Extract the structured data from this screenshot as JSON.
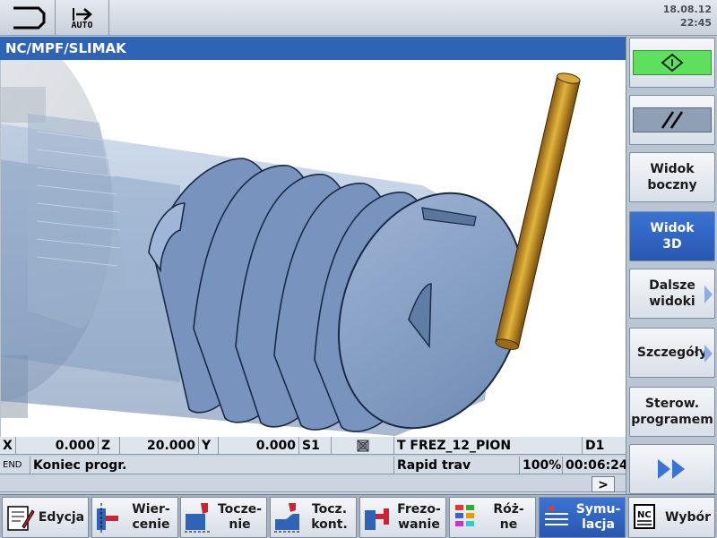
{
  "header": {
    "mode_label": "AUTO",
    "date": "18.08.12",
    "time": "22:45"
  },
  "title": "NC/MPF/SLIMAK",
  "status": {
    "x_label": "X",
    "x_value": "0.000",
    "z_label": "Z",
    "z_value": "20.000",
    "y_label": "Y",
    "y_value": "0.000",
    "s_label": "S1",
    "tool": "T FREZ_12_PION",
    "d": "D1",
    "end_label": "END",
    "message": "Koniec progr.",
    "feed_mode": "Rapid trav",
    "override": "100%",
    "run_time": "00:06:24",
    "expand": ">"
  },
  "vertical_softkeys": [
    {
      "label": "",
      "icon": "start-icon"
    },
    {
      "label": "",
      "icon": "parallel-lines-icon"
    },
    {
      "label": "Widok\nboczny"
    },
    {
      "label": "Widok\n3D",
      "active": true
    },
    {
      "label": "Dalsze\nwidoki"
    },
    {
      "label": "Szczegóły"
    },
    {
      "label": "Sterow.\nprogramem"
    },
    {
      "label": "",
      "icon": "double-right-arrow-icon"
    }
  ],
  "horizontal_softkeys": [
    {
      "label": "Edycja",
      "icon": "edit-icon"
    },
    {
      "label": "Wier-\ncenie",
      "icon": "drilling-icon"
    },
    {
      "label": "Tocze-\nnie",
      "icon": "turning-icon"
    },
    {
      "label": "Tocz.\nkont.",
      "icon": "contour-turning-icon"
    },
    {
      "label": "Frezo-\nwanie",
      "icon": "milling-icon"
    },
    {
      "label": "Róż-\nne",
      "icon": "various-icon"
    },
    {
      "label": "Symu-\nlacja",
      "icon": "simulation-icon",
      "active": true
    },
    {
      "label": "Wybór",
      "icon": "nc-select-icon"
    }
  ],
  "colors": {
    "title_bg": "#2f63b5",
    "active_softkey": "#2f63b5",
    "start_green": "#5ee05e",
    "workpiece": "#7f9dc6",
    "tool_gold": "#c8961e"
  }
}
